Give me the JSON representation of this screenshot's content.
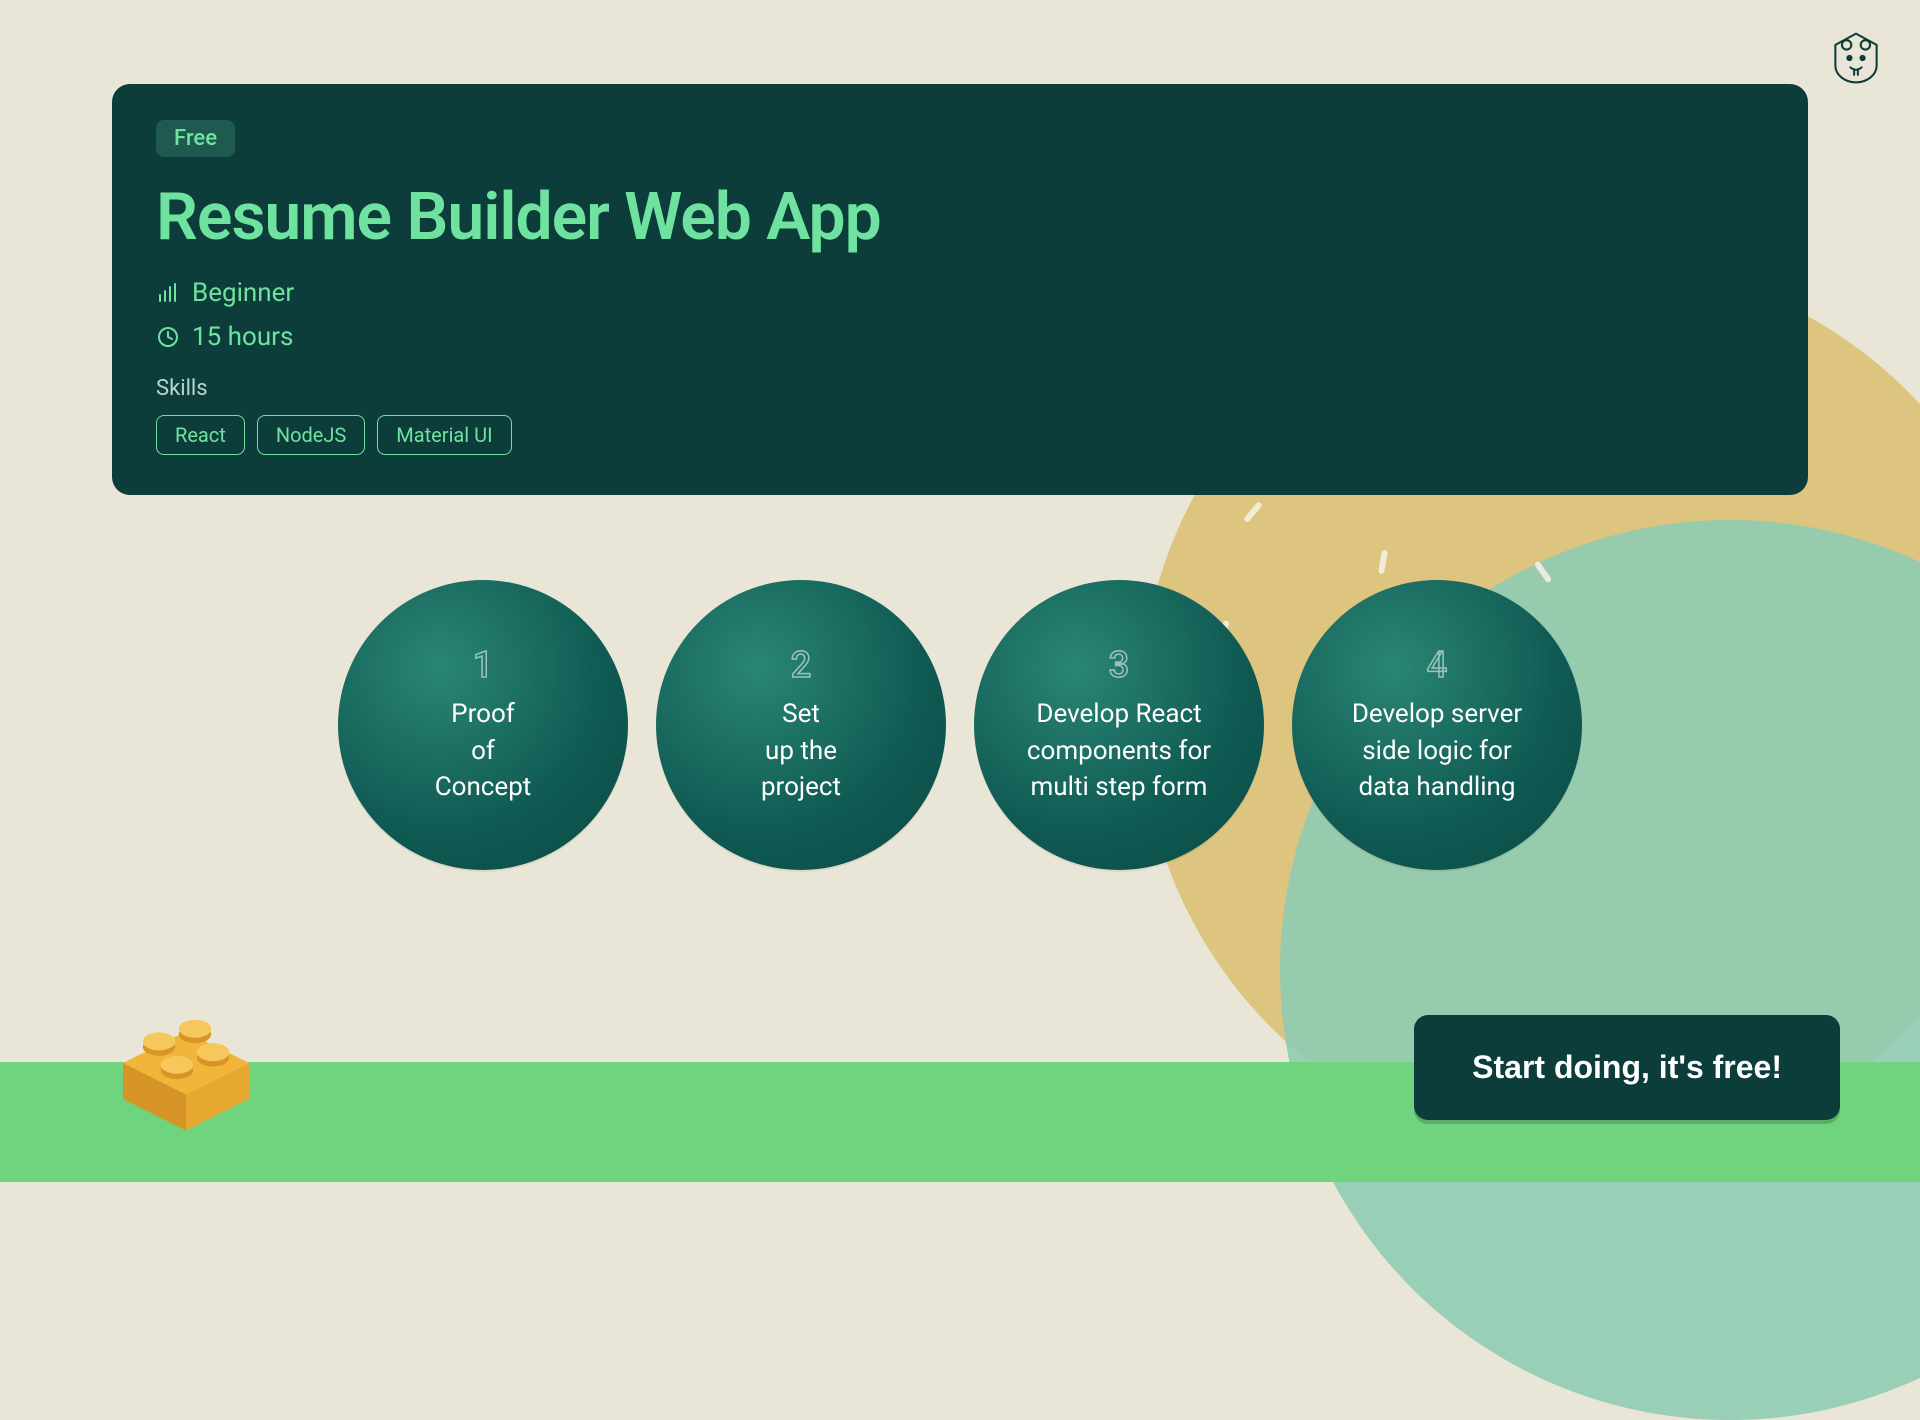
{
  "badge": "Free",
  "title": "Resume Builder Web App",
  "level": "Beginner",
  "duration": "15 hours",
  "skills_label": "Skills",
  "skills": [
    "React",
    "NodeJS",
    "Material UI"
  ],
  "steps": [
    {
      "num": "1",
      "text": "Proof\nof\nConcept"
    },
    {
      "num": "2",
      "text": "Set\nup the\nproject"
    },
    {
      "num": "3",
      "text": "Develop React\ncomponents for\nmulti step form"
    },
    {
      "num": "4",
      "text": "Develop server\nside logic for\ndata handling"
    }
  ],
  "cta": "Start doing, it's free!"
}
